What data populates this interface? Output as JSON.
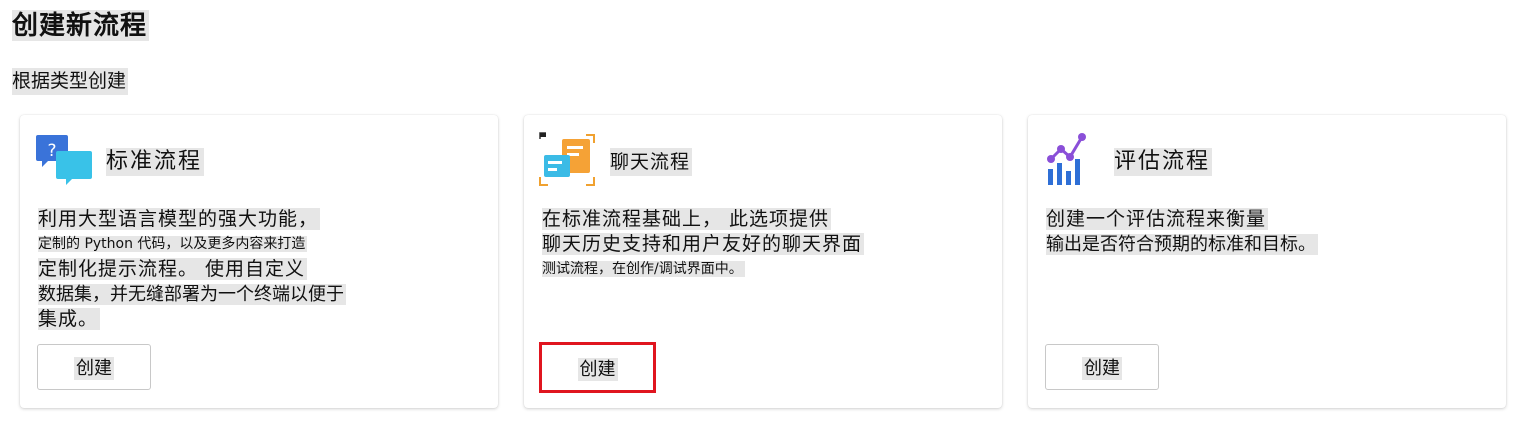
{
  "page_title": "创建新流程",
  "section_title": "根据类型创建",
  "cards": [
    {
      "title": "标准流程",
      "icon": "question-chat-icon",
      "description_lines": [
        "利用大型语言模型的强大功能，",
        "定制的 Python 代码，以及更多内容来打造",
        "定制化提示流程。 使用自定义",
        "数据集，并无缝部署为一个终端以便于",
        "集成。"
      ],
      "button_label": "创建"
    },
    {
      "title": "聊天流程",
      "icon": "chat-document-icon",
      "description_lines": [
        "在标准流程基础上， 此选项提供",
        "聊天历史支持和用户友好的聊天界面",
        "测试流程，在创作/调试界面中。"
      ],
      "button_label": "创建",
      "highlight_color": "#e0151f"
    },
    {
      "title": "评估流程",
      "icon": "chart-evaluation-icon",
      "description_lines": [
        "创建一个评估流程来衡量",
        "输出是否符合预期的标准和目标。"
      ],
      "button_label": "创建"
    }
  ]
}
